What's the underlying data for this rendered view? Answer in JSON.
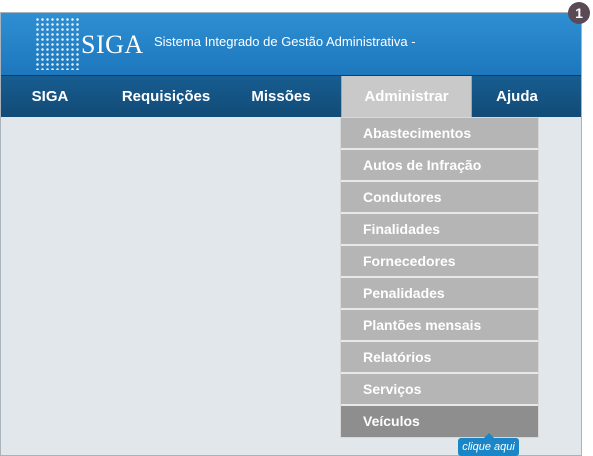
{
  "header": {
    "logo_text": "SIGA",
    "system_title": "Sistema Integrado de Gestão Administrativa -"
  },
  "nav": {
    "items": [
      {
        "label": "SIGA"
      },
      {
        "label": "Requisições"
      },
      {
        "label": "Missões"
      },
      {
        "label": "Administrar",
        "active": true
      },
      {
        "label": "Ajuda"
      }
    ]
  },
  "dropdown": {
    "items": [
      "Abastecimentos",
      "Autos de Infração",
      "Condutores",
      "Finalidades",
      "Fornecedores",
      "Penalidades",
      "Plantões mensais",
      "Relatórios",
      "Serviços",
      "Veículos"
    ]
  },
  "tooltip": {
    "text": "clique aqui"
  },
  "step_badge": "1",
  "colors": {
    "header": "#1d77bd",
    "navbar": "#175d91",
    "active_tab": "#c9c9c9",
    "menu_item": "#b5b5b5",
    "menu_item_hover": "#8e8e8e",
    "tooltip": "#1a86c8"
  }
}
